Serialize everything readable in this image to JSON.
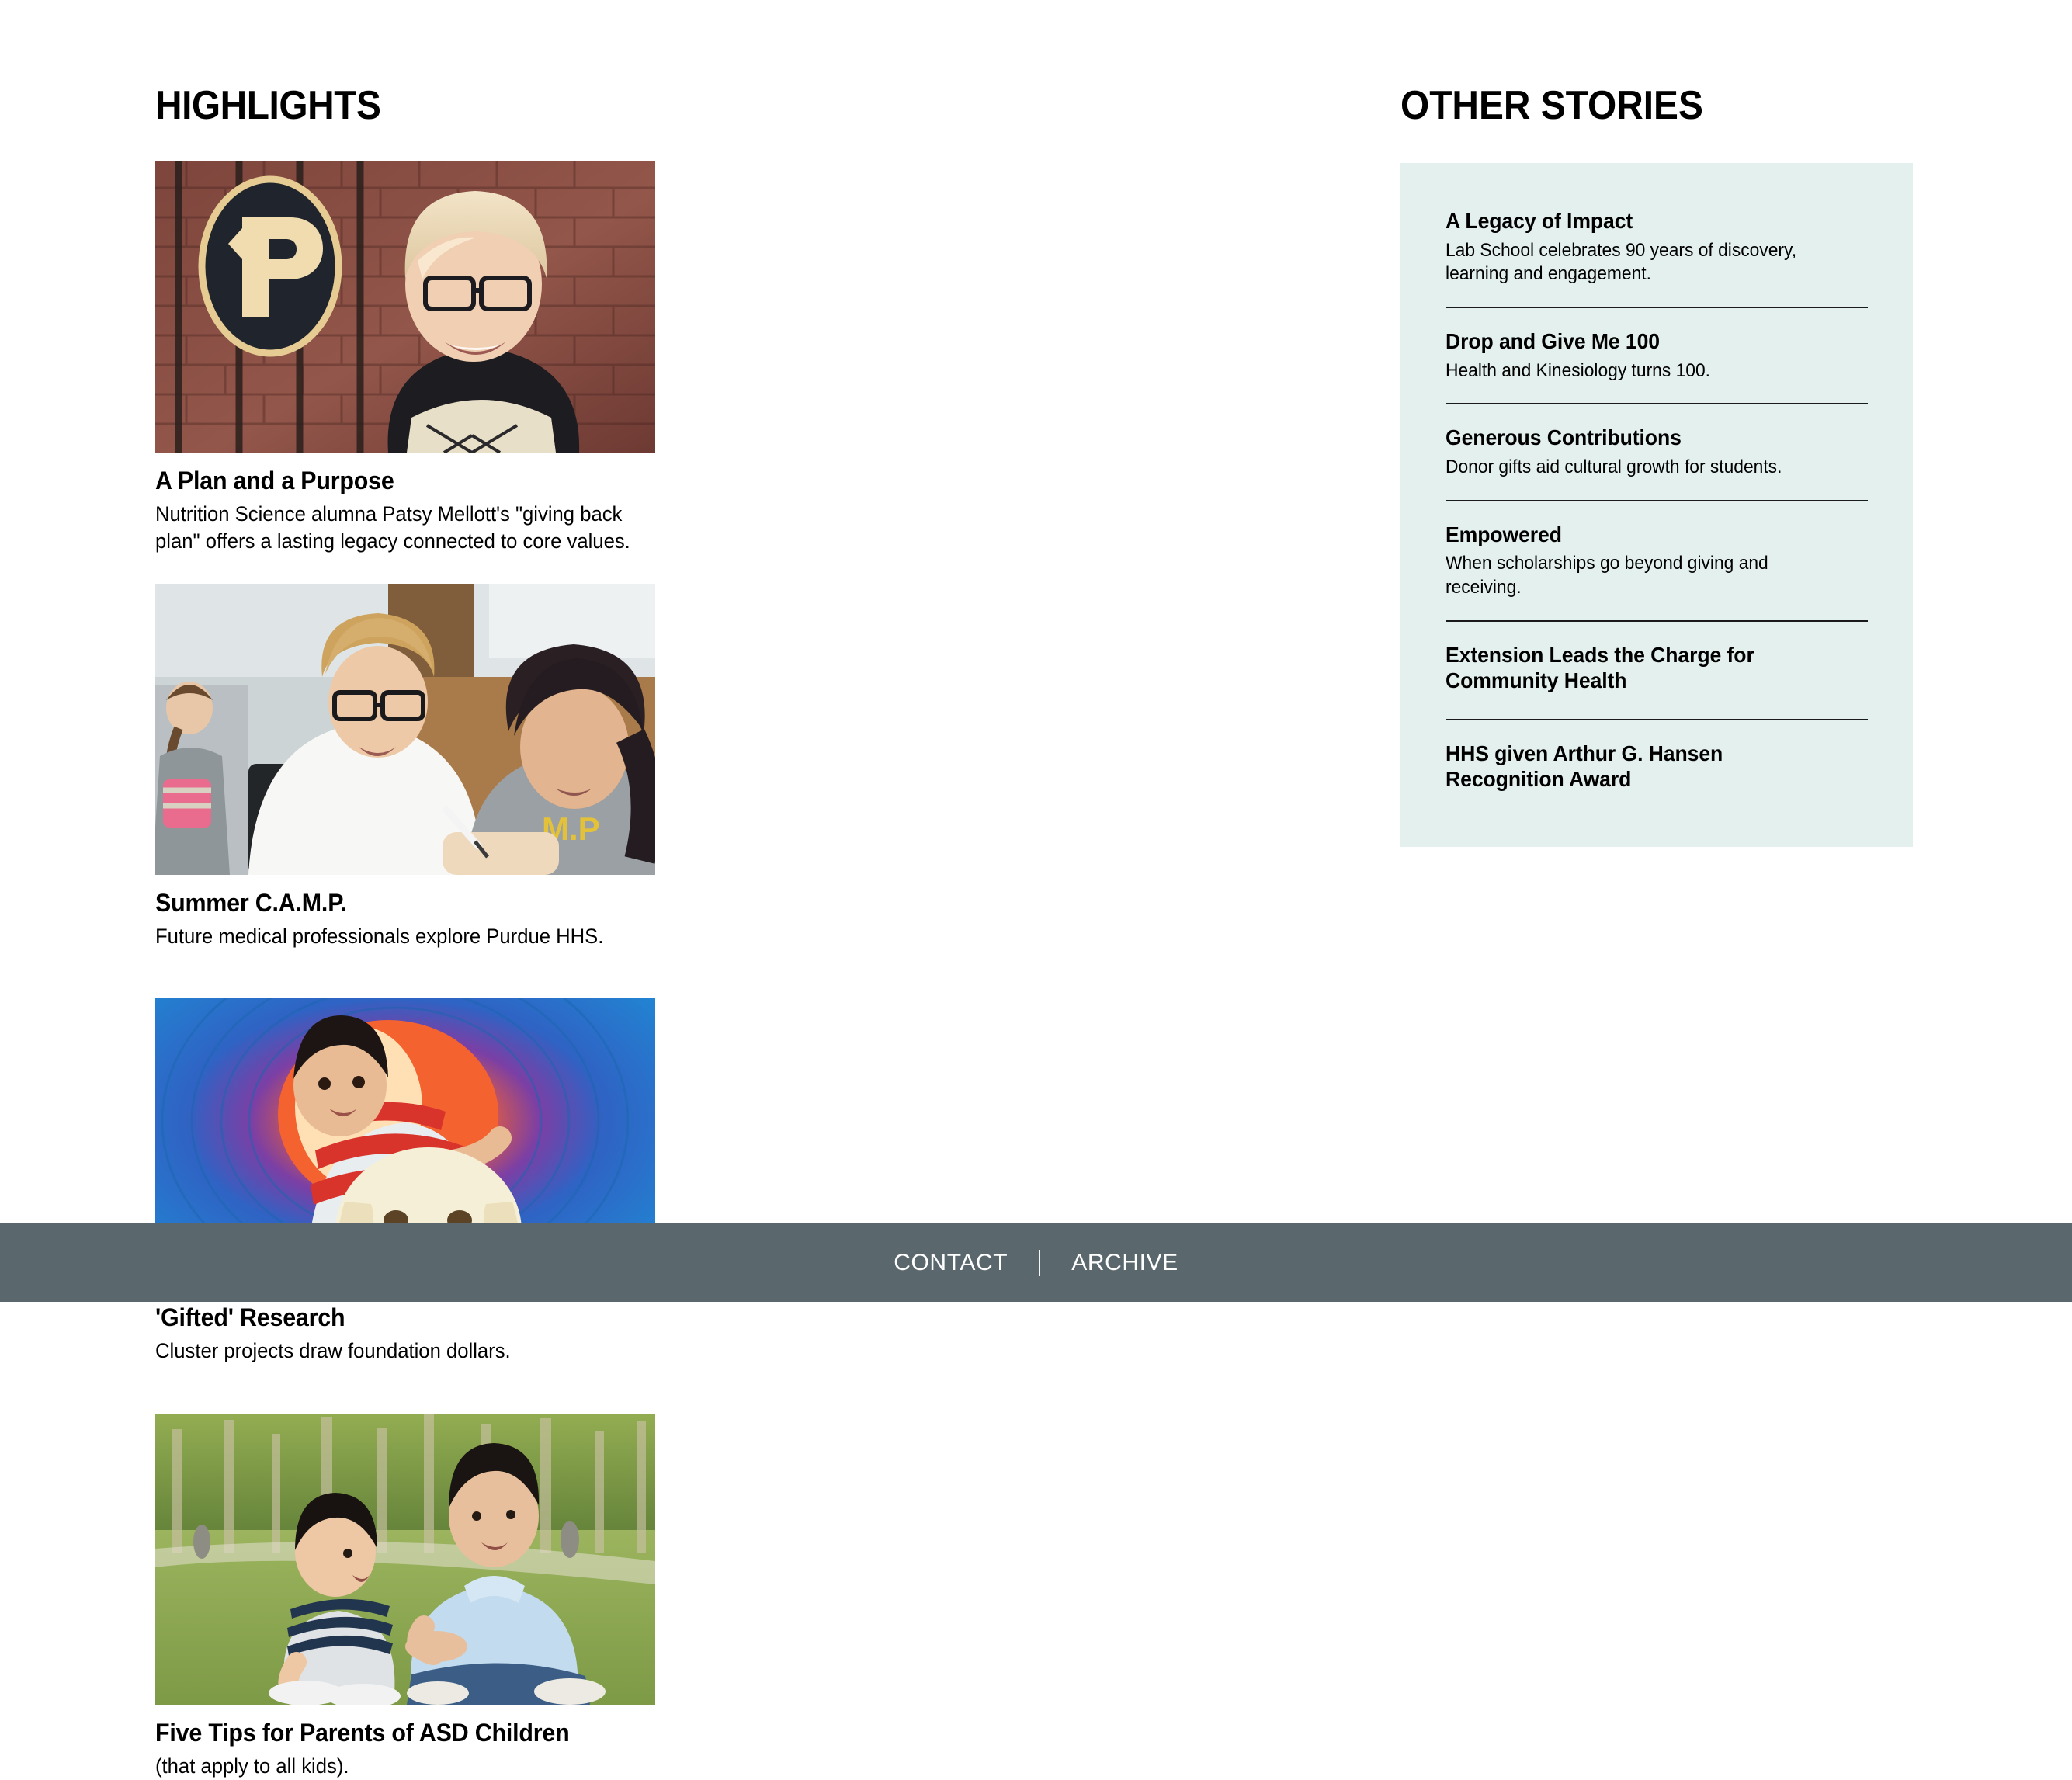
{
  "highlights": {
    "heading": "HIGHLIGHTS",
    "cards": [
      {
        "image_name": "purdue-p-sign-portrait-photo",
        "title": "A Plan and a Purpose",
        "desc": "Nutrition Science alumna Patsy Mellott's \"giving back plan\" offers a lasting legacy connected to core values."
      },
      {
        "image_name": "clinical-training-photo",
        "title": "Summer C.A.M.P.",
        "desc": "Future medical professionals explore Purdue HHS."
      },
      {
        "image_name": "child-tunnel-dog-photo",
        "title": "'Gifted' Research",
        "desc": "Cluster projects draw foundation dollars."
      },
      {
        "image_name": "father-and-son-park-photo",
        "title": "Five Tips for Parents of ASD Children",
        "desc": "(that apply to all kids)."
      }
    ]
  },
  "other_stories": {
    "heading": "OTHER STORIES",
    "panel_color": "#e3f0ee",
    "items": [
      {
        "title": "A Legacy of Impact",
        "desc": "Lab School celebrates 90 years of discovery, learning and engagement."
      },
      {
        "title": "Drop and Give Me 100",
        "desc": "Health and Kinesiology turns 100."
      },
      {
        "title": "Generous Contributions",
        "desc": "Donor gifts aid cultural growth for students."
      },
      {
        "title": "Empowered",
        "desc": "When scholarships go beyond giving and receiving."
      },
      {
        "title": "Extension Leads the Charge for Community Health",
        "desc": ""
      },
      {
        "title": "HHS given Arthur G. Hansen Recognition Award",
        "desc": ""
      }
    ]
  },
  "footer": {
    "background_color": "#5a686e",
    "contact_label": "CONTACT",
    "archive_label": "ARCHIVE"
  }
}
